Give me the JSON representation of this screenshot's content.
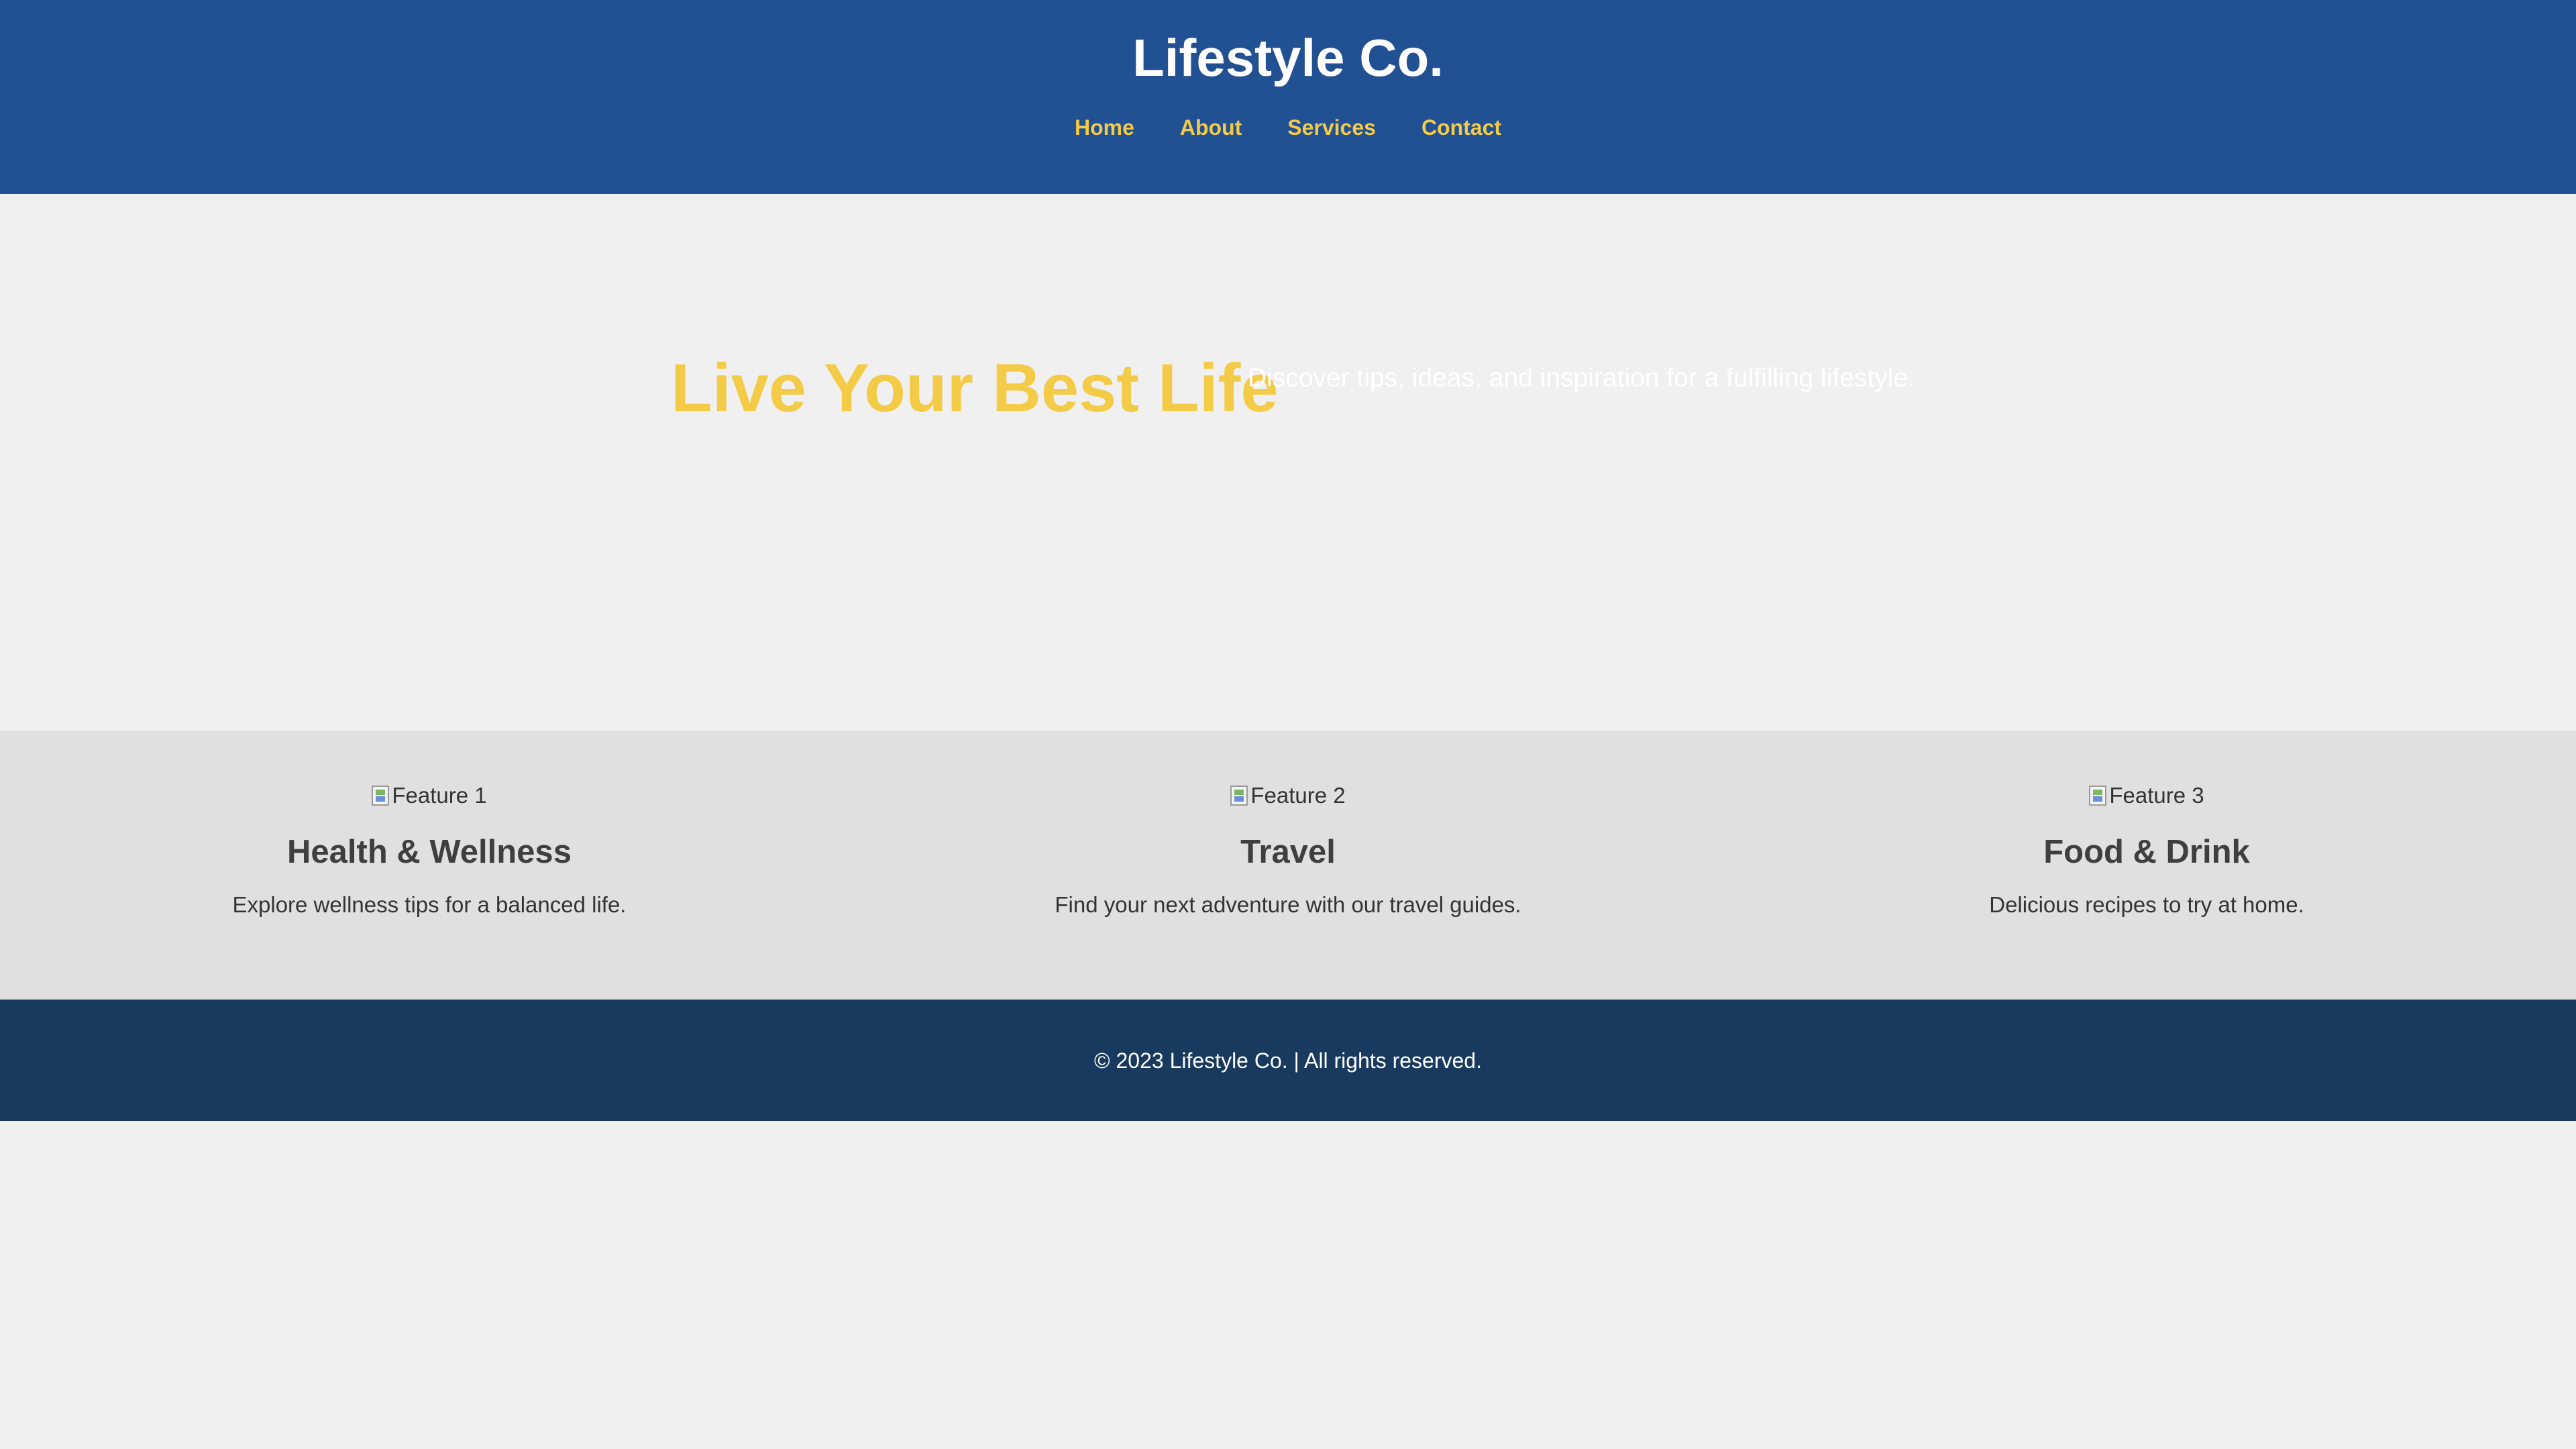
{
  "colors": {
    "header_bg": "#215093",
    "accent_yellow": "#f4cb47",
    "page_bg": "#f0f0f0",
    "features_bg": "#e0e0e0",
    "footer_bg": "#173a5e"
  },
  "header": {
    "brand": "Lifestyle Co.",
    "nav": [
      {
        "label": "Home"
      },
      {
        "label": "About"
      },
      {
        "label": "Services"
      },
      {
        "label": "Contact"
      }
    ]
  },
  "hero": {
    "title": "Live Your Best Life",
    "subtitle": "Discover tips, ideas, and inspiration for a fulfilling lifestyle."
  },
  "features": [
    {
      "image_alt": "Feature 1",
      "icon": "broken-image-icon",
      "title": "Health & Wellness",
      "text": "Explore wellness tips for a balanced life."
    },
    {
      "image_alt": "Feature 2",
      "icon": "broken-image-icon",
      "title": "Travel",
      "text": "Find your next adventure with our travel guides."
    },
    {
      "image_alt": "Feature 3",
      "icon": "broken-image-icon",
      "title": "Food & Drink",
      "text": "Delicious recipes to try at home."
    }
  ],
  "footer": {
    "text": "© 2023 Lifestyle Co. | All rights reserved."
  }
}
